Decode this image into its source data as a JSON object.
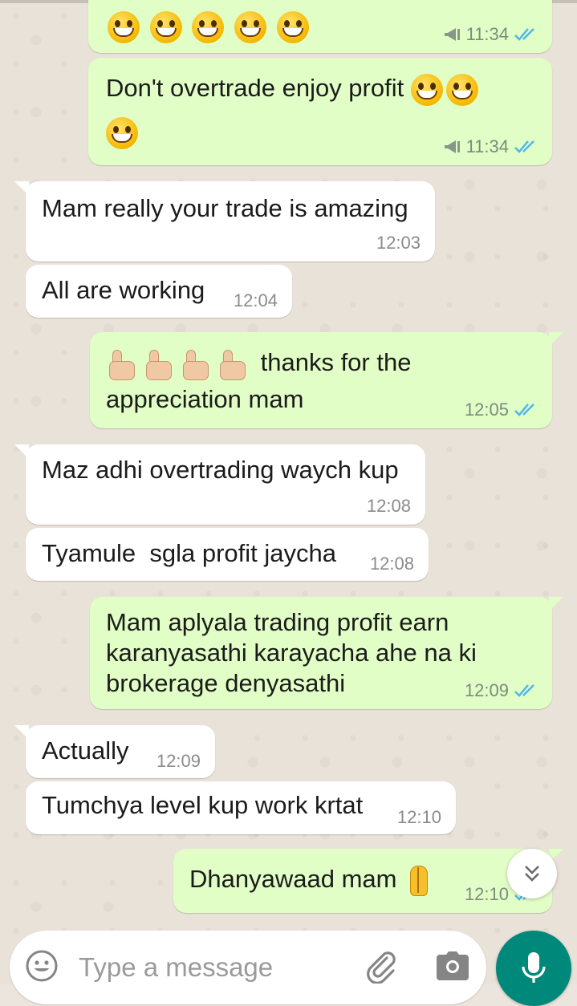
{
  "messages": [
    {
      "type": "outgoing",
      "emoji": [
        "grinning-face",
        "grinning-face",
        "grinning-face",
        "grinning-face",
        "grinning-face"
      ],
      "text": "",
      "time": "11:34",
      "forwarded_icon": "megaphone-icon",
      "status": "read"
    },
    {
      "type": "outgoing",
      "text": "Don't overtrade enjoy profit",
      "emoji": [
        "grinning-face",
        "grinning-face",
        "grinning-face"
      ],
      "time": "11:34",
      "forwarded_icon": "megaphone-icon",
      "status": "read"
    },
    {
      "type": "incoming",
      "text": "Mam really your trade is amazing",
      "time": "12:03"
    },
    {
      "type": "incoming",
      "text": "All are working",
      "time": "12:04"
    },
    {
      "type": "outgoing",
      "emoji": [
        "thumbs-up",
        "thumbs-up",
        "thumbs-up",
        "thumbs-up"
      ],
      "text_line1": "thanks for the",
      "text_line2": "appreciation mam",
      "time": "12:05",
      "status": "read"
    },
    {
      "type": "incoming",
      "text": "Maz adhi overtrading waych kup",
      "time": "12:08"
    },
    {
      "type": "incoming",
      "text": "Tyamule  sgla profit jaycha",
      "time": "12:08"
    },
    {
      "type": "outgoing",
      "text_line1": "Mam aplyala trading profit earn",
      "text_line2": "karanyasathi karayacha ahe na ki",
      "text_line3": "brokerage denyasathi",
      "time": "12:09",
      "status": "read"
    },
    {
      "type": "incoming",
      "text": "Actually",
      "time": "12:09"
    },
    {
      "type": "incoming",
      "text": "Tumchya level kup work krtat",
      "time": "12:10"
    },
    {
      "type": "outgoing",
      "text": "Dhanyawaad mam",
      "emoji": [
        "folded-hands"
      ],
      "time": "12:10",
      "status": "read"
    }
  ],
  "composer": {
    "placeholder": "Type a message",
    "icons": [
      "emoji-icon",
      "attach-icon",
      "camera-icon",
      "mic-icon"
    ]
  },
  "scroll_button_icon": "double-chevron-down-icon",
  "colors": {
    "outgoing_bubble": "#e1fec6",
    "incoming_bubble": "#ffffff",
    "read_ticks": "#4fb6ec",
    "accent": "#00897b"
  }
}
